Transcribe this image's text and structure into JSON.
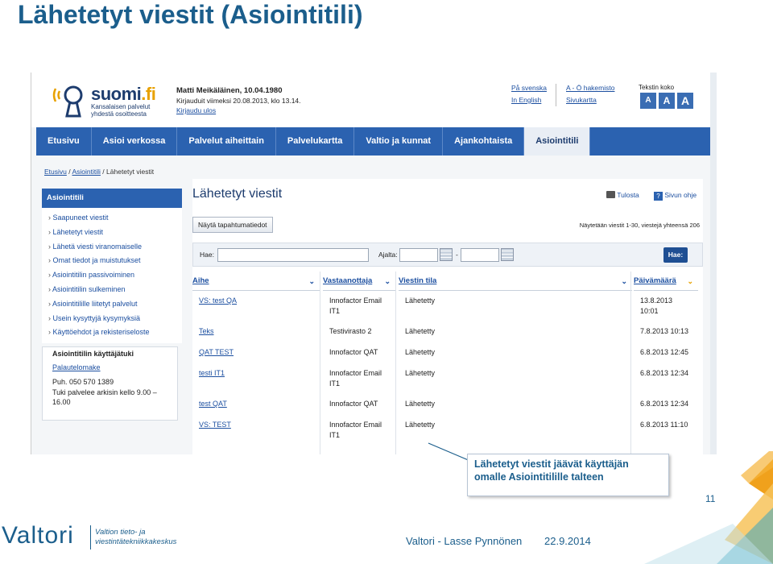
{
  "slide": {
    "title": "Lähetetyt viestit (Asiointitili)",
    "page_number": "11"
  },
  "header": {
    "logo_text_a": "suomi",
    "logo_text_b": ".fi",
    "logo_sub_1": "Kansalaisen palvelut",
    "logo_sub_2": "yhdestä osoitteesta",
    "user_name": "Matti Meikäläinen, 10.04.1980",
    "last_login": "Kirjauduit viimeksi 20.08.2013, klo 13.14.",
    "logout": "Kirjaudu ulos",
    "lang_sv": "På svenska",
    "lang_en": "In English",
    "az_index": "A - Ö hakemisto",
    "sitemap": "Sivukartta",
    "text_size_label": "Tekstin koko",
    "text_size_options": [
      "A",
      "A",
      "A"
    ]
  },
  "nav": [
    "Etusivu",
    "Asioi verkossa",
    "Palvelut aiheittain",
    "Palvelukartta",
    "Valtio ja kunnat",
    "Ajankohtaista",
    "Asiointitili"
  ],
  "breadcrumb": {
    "home": "Etusivu",
    "sep1": " / ",
    "section": "Asiointitili",
    "sep2": " / ",
    "current": "Lähetetyt viestit"
  },
  "sidebar": {
    "title": "Asiointitili",
    "items": [
      "Saapuneet viestit",
      "Lähetetyt viestit",
      "Lähetä viesti viranomaiselle",
      "Omat tiedot ja muistutukset",
      "Asiointitilin passivoiminen",
      "Asiointitilin sulkeminen",
      "Asiointitilille liitetyt palvelut",
      "Usein kysyttyjä kysymyksiä",
      "Käyttöehdot ja rekisteriseloste"
    ],
    "help_title": "Asiointitilin käyttäjätuki",
    "help_link": "Palautelomake",
    "help_phone": "Puh. 050 570 1389",
    "help_hours_1": "Tuki palvelee arkisin kello 9.00 –",
    "help_hours_2": "16.00"
  },
  "main": {
    "title": "Lähetetyt viestit",
    "print": "Tulosta",
    "help": "Sivun ohje",
    "show_events": "Näytä tapahtumatiedot",
    "count_text": "Näytetään viestit 1-30, viestejä yhteensä 206",
    "search_label": "Hae:",
    "period_label": "Ajalta:",
    "dash": "-",
    "search_button": "Hae:"
  },
  "table": {
    "columns": [
      "Aihe",
      "Vastaanottaja",
      "Viestin tila",
      "Päivämäärä"
    ],
    "rows": [
      {
        "subject": "VS: test QA",
        "recipient_1": "Innofactor Email",
        "recipient_2": "IT1",
        "status": "Lähetetty",
        "date_1": "13.8.2013",
        "date_2": "10:01"
      },
      {
        "subject": "Teks",
        "recipient_1": "Testivirasto 2",
        "recipient_2": "",
        "status": "Lähetetty",
        "date_1": "7.8.2013 10:13",
        "date_2": ""
      },
      {
        "subject": "QAT TEST",
        "recipient_1": "Innofactor QAT",
        "recipient_2": "",
        "status": "Lähetetty",
        "date_1": "6.8.2013 12:45",
        "date_2": ""
      },
      {
        "subject": "testi IT1",
        "recipient_1": "Innofactor Email",
        "recipient_2": "IT1",
        "status": "Lähetetty",
        "date_1": "6.8.2013 12:34",
        "date_2": ""
      },
      {
        "subject": "test QAT",
        "recipient_1": "Innofactor QAT",
        "recipient_2": "",
        "status": "Lähetetty",
        "date_1": "6.8.2013 12:34",
        "date_2": ""
      },
      {
        "subject": "VS: TEST",
        "recipient_1": "Innofactor Email",
        "recipient_2": "IT1",
        "status": "Lähetetty",
        "date_1": "6.8.2013 11:10",
        "date_2": ""
      }
    ]
  },
  "callout": {
    "line_1": "Lähetetyt viestit jäävät käyttäjän",
    "line_2": "omalle Asiointitilille talteen"
  },
  "footer": {
    "logo": "Valtori",
    "logo_sub_1": "Valtion tieto- ja",
    "logo_sub_2": "viestintätekniikkakeskus",
    "author": "Valtori - Lasse Pynnönen",
    "date": "22.9.2014"
  },
  "colors": {
    "title_blue": "#1b5e8c",
    "nav_blue": "#2b62b0",
    "link_blue": "#1c4fa0",
    "accent_orange": "#f0a11c",
    "accent_teal": "#3aa6c0"
  }
}
